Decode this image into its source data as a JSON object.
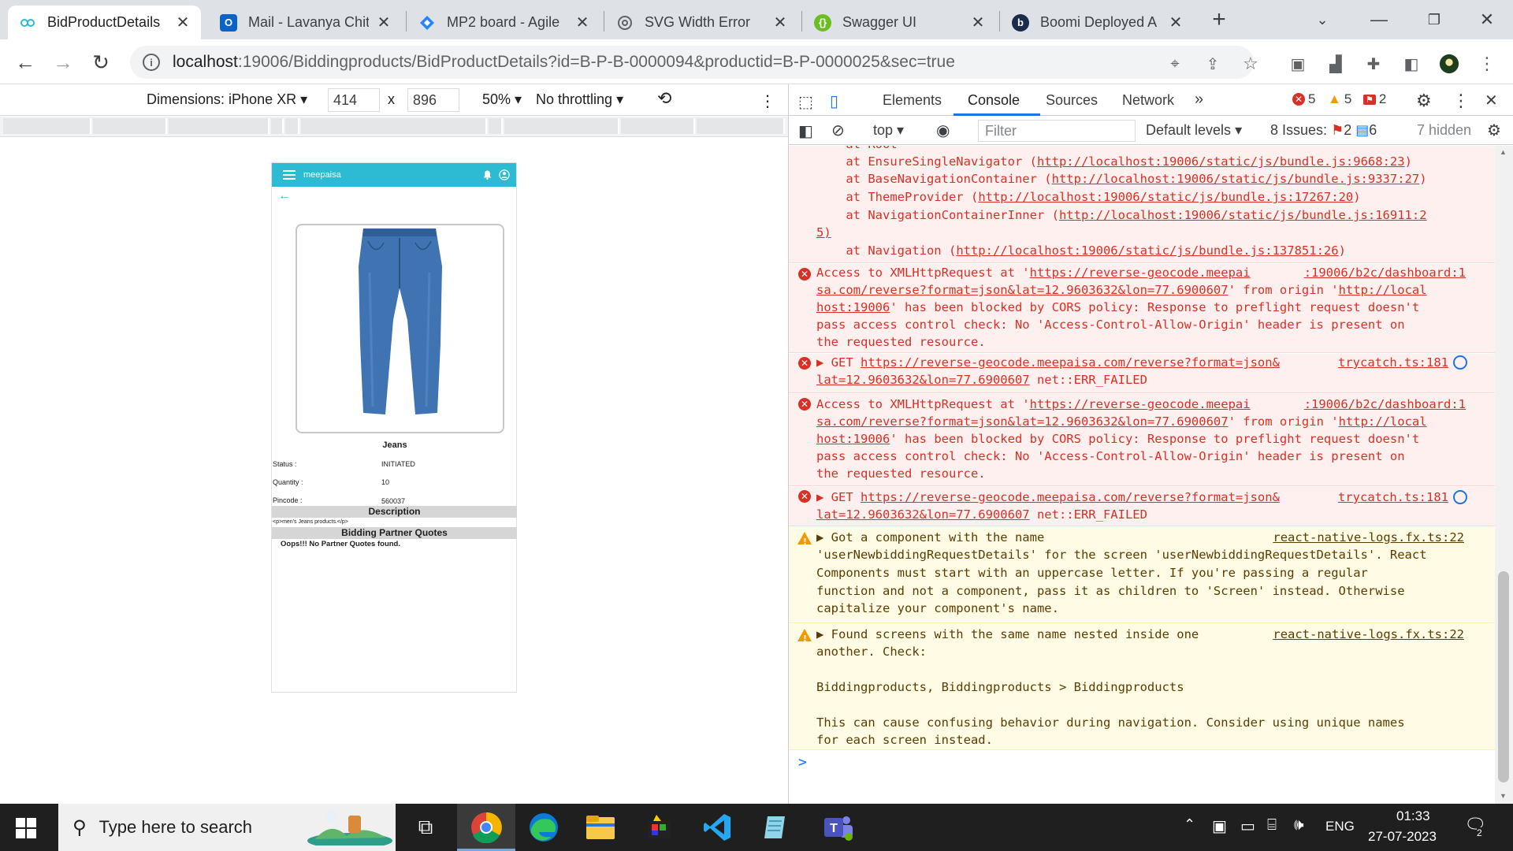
{
  "browser": {
    "tabs": [
      {
        "title": "BidProductDetails",
        "icon": "meepaisa-favicon-icon",
        "active": true
      },
      {
        "title": "Mail - Lavanya Chit",
        "icon": "outlook-icon",
        "active": false
      },
      {
        "title": "MP2 board - Agile",
        "icon": "jira-icon",
        "active": false
      },
      {
        "title": "SVG Width Error",
        "icon": "chatgpt-icon",
        "active": false
      },
      {
        "title": "Swagger UI",
        "icon": "swagger-icon",
        "active": false
      },
      {
        "title": "Boomi Deployed A",
        "icon": "boomi-icon",
        "active": false
      }
    ],
    "url_host": "localhost",
    "url_rest": ":19006/Biddingproducts/BidProductDetails?id=B-P-B-0000094&productid=B-P-0000025&sec=true"
  },
  "device_toolbar": {
    "dimensions_label": "Dimensions: iPhone XR",
    "width": "414",
    "times": "x",
    "height": "896",
    "zoom": "50%",
    "throttling": "No throttling"
  },
  "phone": {
    "brand": "meepaisa",
    "product_name": "Jeans",
    "rows": [
      {
        "label": "Status :",
        "value": "INITIATED"
      },
      {
        "label": "Quantity :",
        "value": "10"
      },
      {
        "label": "Pincode :",
        "value": "560037"
      }
    ],
    "description_title": "Description",
    "description_text": "<p>men's Jeans products.</p>",
    "quotes_title": "Bidding Partner Quotes",
    "quotes_empty": "Oops!!! No Partner Quotes found."
  },
  "devtools": {
    "tabs": [
      "Elements",
      "Console",
      "Sources",
      "Network"
    ],
    "active_tab": "Console",
    "error_count": "5",
    "warning_count": "5",
    "issue_count": "2",
    "context": "top",
    "filter_placeholder": "Filter",
    "levels": "Default levels",
    "issues_label": "8 Issues:",
    "issues_errors": "2",
    "issues_info": "6",
    "hidden_label": "7 hidden",
    "stack_lines": [
      "    at Root",
      "    at EnsureSingleNavigator (",
      "    at BaseNavigationContainer (",
      "    at ThemeProvider (",
      "    at NavigationContainerInner (",
      "    at Navigation ("
    ],
    "stack_links": [
      "",
      "http://localhost:19006/static/js/bundle.js:9668:23",
      "http://localhost:19006/static/js/bundle.js:9337:27",
      "http://localhost:19006/static/js/bundle.js:17267:20",
      "http://localhost:19006/static/js/bundle.js:16911:2",
      "http://localhost:19006/static/js/bundle.js:137851:26"
    ],
    "stack_wrap": "5)",
    "cors_error": {
      "line1_pre": "Access to XMLHttpRequest at '",
      "line1_link": "https://reverse-geocode.meepai",
      "line1_src": ":19006/b2c/dashboard:1",
      "line2_link": "sa.com/reverse?format=json&lat=12.9603632&lon=77.6900607",
      "line2_post": "' from origin '",
      "line2_origin": "http://local",
      "line3_origin": "host:19006",
      "line3_post": "' has been blocked by CORS policy: Response to preflight request doesn't",
      "line4": "pass access control check: No 'Access-Control-Allow-Origin' header is present on",
      "line5": "the requested resource."
    },
    "get_error": {
      "prefix": "GET ",
      "link": "https://reverse-geocode.meepaisa.com/reverse?format=json&",
      "source": "trycatch.ts:181",
      "line2_link": "lat=12.9603632&lon=77.6900607",
      "line2_post": " net::ERR_FAILED"
    },
    "warn1": {
      "source": "react-native-logs.fx.ts:22",
      "lines": [
        "Got a component with the name",
        "'userNewbiddingRequestDetails' for the screen 'userNewbiddingRequestDetails'. React",
        "Components must start with an uppercase letter. If you're passing a regular",
        "function and not a component, pass it as children to 'Screen' instead. Otherwise",
        "capitalize your component's name."
      ]
    },
    "warn2": {
      "source": "react-native-logs.fx.ts:22",
      "lines": [
        "Found screens with the same name nested inside one",
        "another. Check:",
        "",
        "Biddingproducts, Biddingproducts > Biddingproducts",
        "",
        "This can cause confusing behavior during navigation. Consider using unique names",
        "for each screen instead."
      ]
    },
    "prompt": ">"
  },
  "taskbar": {
    "search_placeholder": "Type here to search",
    "language": "ENG",
    "time": "01:33",
    "date": "27-07-2023",
    "notification_count": "2"
  },
  "colors": {
    "error": "#d93025",
    "warning": "#f29900",
    "accent": "#1a73e8",
    "phone_header": "#2dbad3"
  }
}
